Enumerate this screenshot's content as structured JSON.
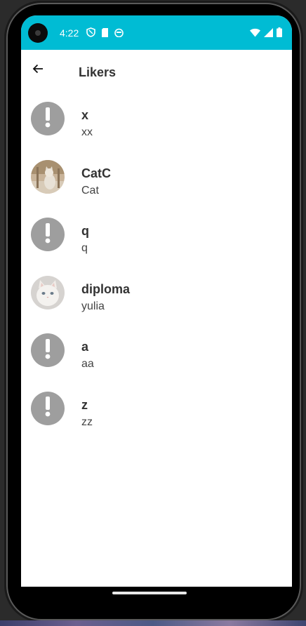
{
  "status_bar": {
    "time": "4:22",
    "left_icons": [
      "shield-icon",
      "sd-card-icon",
      "android-icon"
    ],
    "right_icons": [
      "wifi-icon",
      "signal-icon",
      "battery-icon"
    ],
    "color": "#00bcd4"
  },
  "toolbar": {
    "title": "Likers",
    "back_icon": "arrow-back-icon"
  },
  "likers": [
    {
      "name": "x",
      "username": "xx",
      "avatar": "default"
    },
    {
      "name": "CatC",
      "username": "Cat",
      "avatar": "cat-photo"
    },
    {
      "name": "q",
      "username": "q",
      "avatar": "default"
    },
    {
      "name": "diploma",
      "username": "yulia",
      "avatar": "white-kitten-photo"
    },
    {
      "name": "a",
      "username": "aa",
      "avatar": "default"
    },
    {
      "name": "z",
      "username": "zz",
      "avatar": "default"
    }
  ]
}
